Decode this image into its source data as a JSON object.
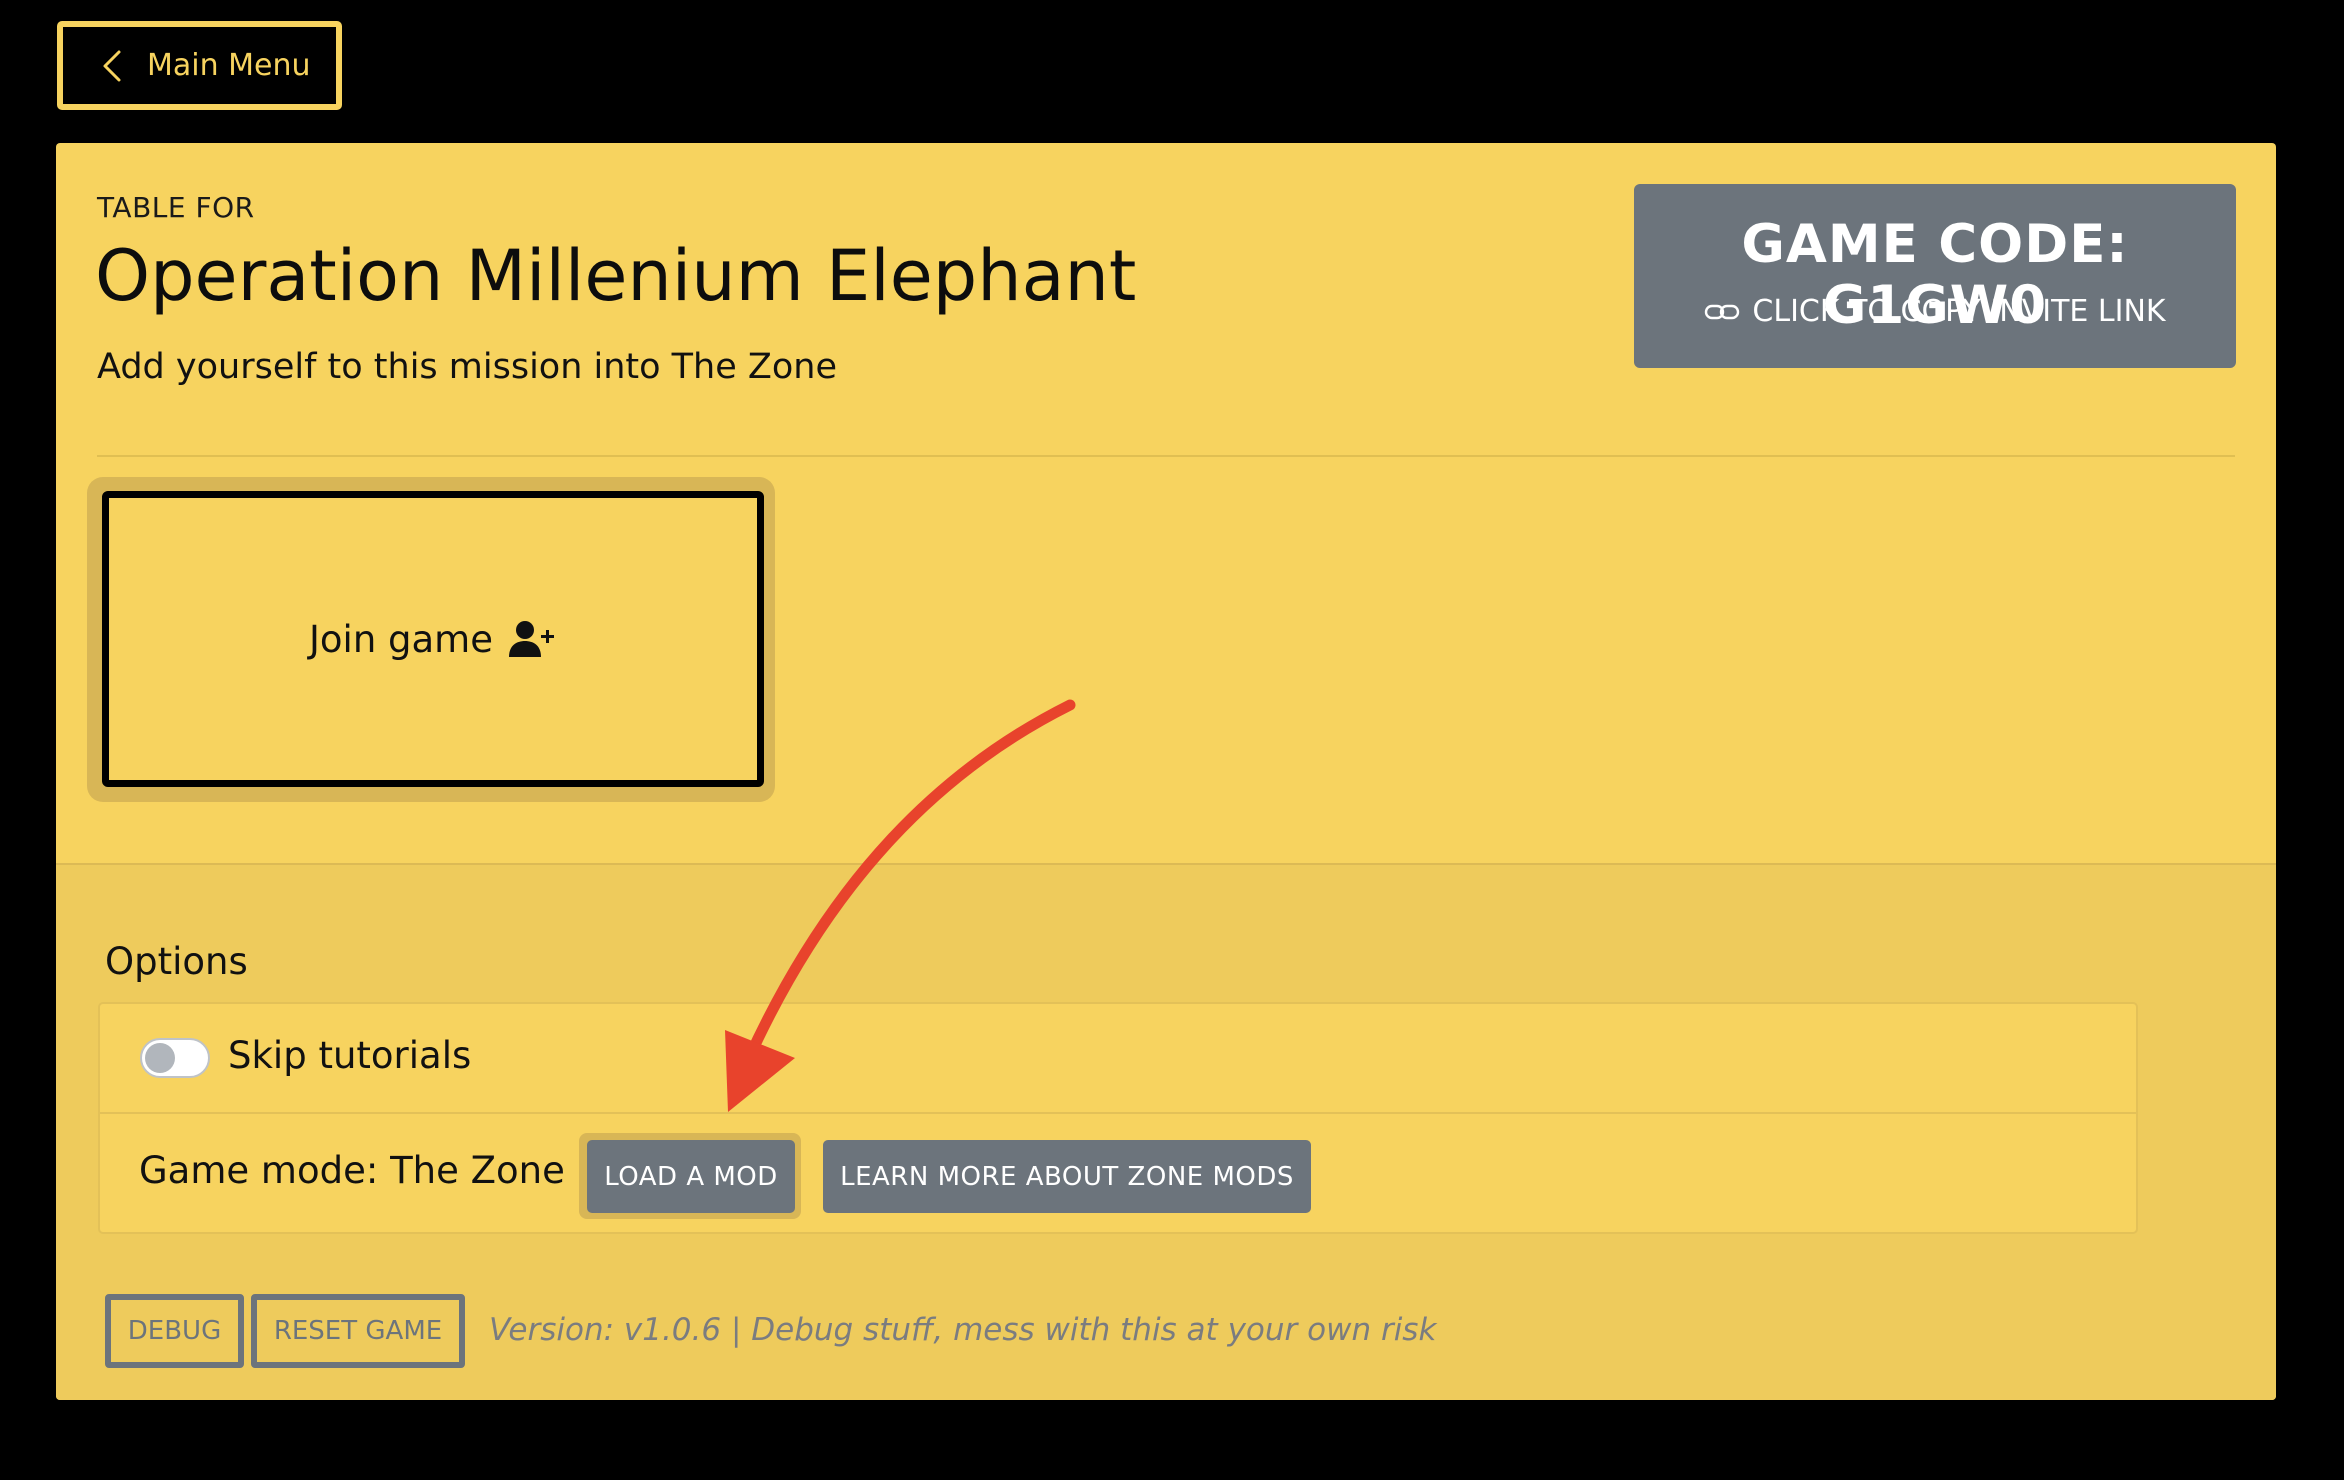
{
  "nav": {
    "back_label": "Main Menu",
    "back_icon": "chevron-left-icon"
  },
  "header": {
    "table_for": "TABLE FOR",
    "title": "Operation Millenium Elephant",
    "subtitle": "Add yourself to this mission into The Zone"
  },
  "game_code": {
    "title": "GAME CODE: G1GW0",
    "copy_label": "CLICK TO COPY INVITE LINK",
    "copy_icon": "link-icon"
  },
  "join": {
    "label": "Join game",
    "icon": "user-plus-icon"
  },
  "options": {
    "heading": "Options",
    "skip_tutorials": {
      "label": "Skip tutorials",
      "enabled": false
    },
    "game_mode_label": "Game mode: The Zone",
    "load_mod_label": "LOAD A MOD",
    "learn_more_label": "LEARN MORE ABOUT ZONE MODS"
  },
  "footer": {
    "debug_label": "DEBUG",
    "reset_label": "RESET GAME",
    "version_text": "Version: v1.0.6 | Debug stuff, mess with this at your own risk"
  },
  "colors": {
    "background": "#000000",
    "card": "#f7d35f",
    "options_area": "#eecb5c",
    "button_gray": "#6c747c",
    "annotation_arrow": "#e8432c"
  }
}
